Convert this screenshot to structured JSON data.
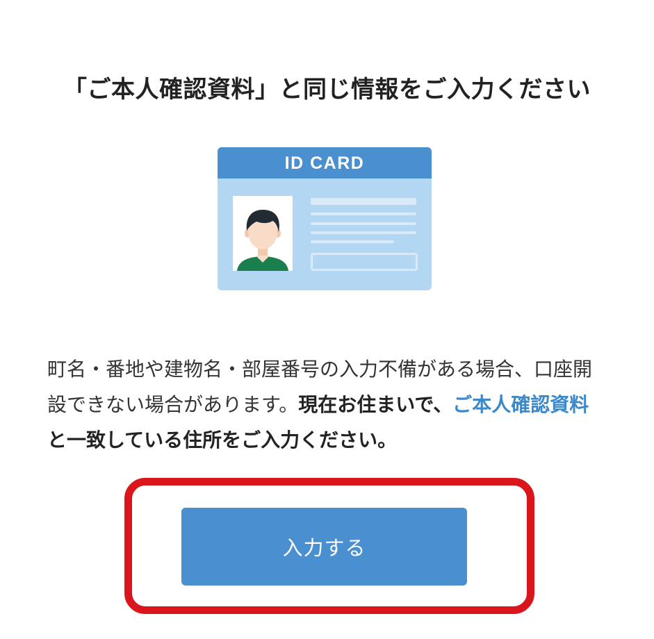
{
  "header": {
    "title": "「ご本人確認資料」と同じ情報をご入力ください"
  },
  "id_card": {
    "header_text": "ID CARD",
    "icon": "id-card-illustration",
    "colors": {
      "header": "#4a8fd0",
      "body": "#b3d6f2",
      "shirt": "#1a7f4d",
      "hair": "#222a33",
      "skin": "#f8dcc8"
    }
  },
  "description": {
    "text_normal": "町名・番地や建物名・部屋番号の入力不備がある場合、口座開設できない場合があります。",
    "text_bold_before": "現在お住まいで、",
    "text_link": "ご本人確認資料",
    "text_bold_after": "と一致している住所をご入力ください。"
  },
  "actions": {
    "submit_label": "入力する"
  },
  "colors": {
    "accent": "#4a8fd0",
    "link": "#3c88c8",
    "highlight_frame": "#d8161c"
  }
}
